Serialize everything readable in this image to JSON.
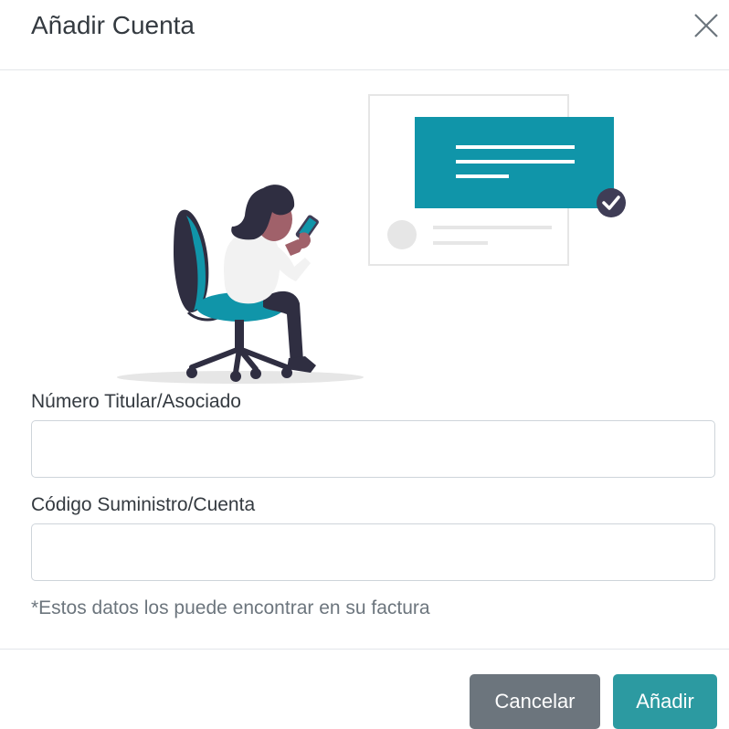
{
  "modal": {
    "title": "Añadir Cuenta",
    "close_icon": "close-icon"
  },
  "illustration": {
    "name": "person-on-phone-illustration",
    "colors": {
      "accent": "#1095a9",
      "dark": "#2f2e41",
      "skin": "#a0616a",
      "shirt": "#f2f2f2",
      "check_badge": "#3f3d56"
    }
  },
  "form": {
    "holder_label": "Número Titular/Asociado",
    "holder_value": "",
    "supply_label": "Código Suministro/Cuenta",
    "supply_value": "",
    "help_text": "*Estos datos los puede encontrar en su factura"
  },
  "footer": {
    "cancel_label": "Cancelar",
    "add_label": "Añadir"
  },
  "colors": {
    "cancel_button": "#6c757d",
    "add_button": "#2c9aa1",
    "divider": "#e3e6ea",
    "input_border": "#ced4da"
  }
}
